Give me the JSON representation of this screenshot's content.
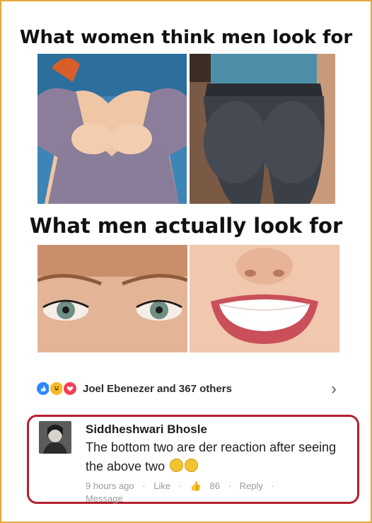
{
  "meme": {
    "top_title": "What women think men look for",
    "bottom_title": "What men actually look for"
  },
  "reactions": {
    "icons": [
      "like-icon",
      "haha-icon",
      "love-icon"
    ],
    "summary": "Joel Ebenezer and 367 others"
  },
  "comment": {
    "author": "Siddheshwari Bhosle",
    "text": "The bottom two are der reaction after seeing the above two",
    "time": "9 hours ago",
    "like_label": "Like",
    "like_count": "86",
    "reply_label": "Reply",
    "message_label": "Message"
  },
  "colors": {
    "frame": "#e2a93b",
    "highlight": "#b51f2e",
    "like": "#2d88ff",
    "haha": "#f7b928",
    "love": "#f33e58"
  }
}
